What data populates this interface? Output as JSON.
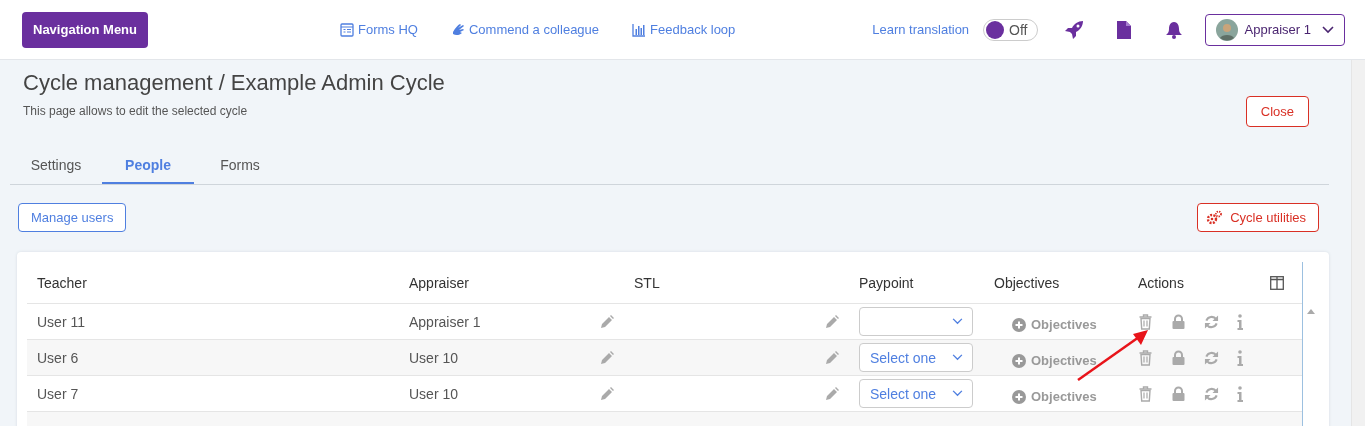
{
  "nav_button": "Navigation Menu",
  "top_links": [
    {
      "label": "Forms HQ",
      "kind": "forms"
    },
    {
      "label": "Commend a colleague",
      "kind": "commend"
    },
    {
      "label": "Feedback loop",
      "kind": "feedback"
    }
  ],
  "translation": {
    "label": "Learn translation",
    "toggle": "Off",
    "on": false
  },
  "user_menu": "Appraiser 1",
  "page": {
    "title": "Cycle management / Example Admin Cycle",
    "subtitle": "This page allows to edit the selected cycle",
    "close": "Close"
  },
  "tabs": [
    {
      "label": "Settings",
      "selected": false
    },
    {
      "label": "People",
      "selected": true
    },
    {
      "label": "Forms",
      "selected": false
    }
  ],
  "manage_users": "Manage users",
  "cycle_utilities": "Cycle utilities",
  "table": {
    "columns": [
      "Teacher",
      "Appraiser",
      "STL",
      "Paypoint",
      "Objectives",
      "Actions"
    ],
    "rows": [
      {
        "teacher": "User 11",
        "appraiser": "Appraiser 1",
        "objectives": "Objectives"
      },
      {
        "teacher": "User 6",
        "appraiser": "User 10",
        "paypoint": "Select one",
        "objectives": "Objectives"
      },
      {
        "teacher": "User 7",
        "appraiser": "User 10",
        "paypoint": "Select one",
        "objectives": "Objectives"
      }
    ]
  }
}
